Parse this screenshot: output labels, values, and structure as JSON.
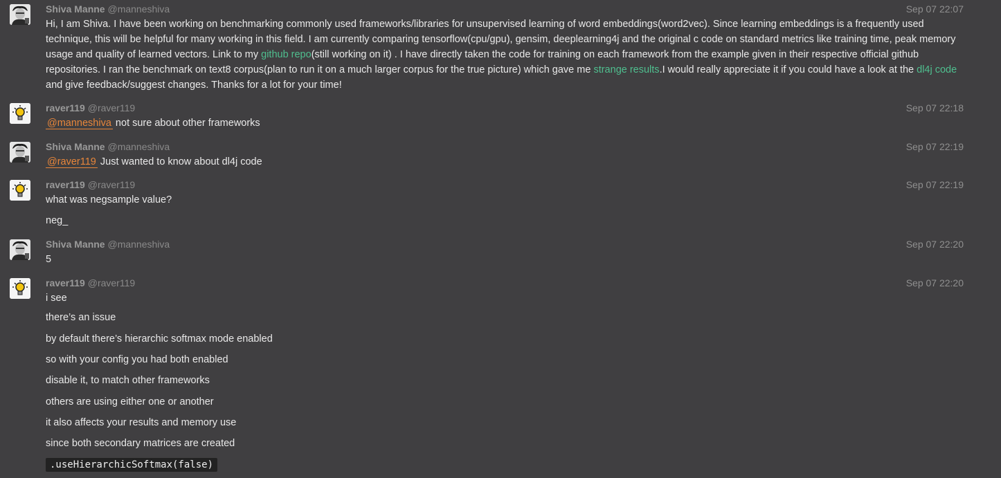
{
  "messages": [
    {
      "name": "Shiva Manne",
      "handle": "@manneshiva",
      "time": "Sep 07 22:07",
      "body": {
        "t1": "Hi, I am Shiva. I have been working on benchmarking commonly used frameworks/libraries for unsupervised learning of word embeddings(word2vec). Since learning embeddings is a frequently used technique, this will be helpful for many working in this field. I am currently comparing tensorflow(cpu/gpu), gensim, deeplearning4j and the original c code on standard metrics like training time, peak memory usage and quality of learned vectors. Link to my ",
        "link1": "github repo",
        "t2": "(still working on it) . I have directly taken the code for training on each framework from the example given in their respective official github repositories. I ran the benchmark on text8 corpus(plan to run it on a much larger corpus for the true picture) which gave me ",
        "link2": "strange results",
        "t3": ".I would really appreciate it if you could have a look at the ",
        "link3": "dl4j code",
        "t4": " and give feedback/suggest changes. Thanks for a lot for your time!"
      }
    },
    {
      "name": "raver119",
      "handle": "@raver119",
      "time": "Sep 07 22:18",
      "mention": "@manneshiva",
      "text": " not sure about other frameworks"
    },
    {
      "name": "Shiva Manne",
      "handle": "@manneshiva",
      "time": "Sep 07 22:19",
      "mention": "@raver119",
      "text": " Just wanted to know about dl4j code"
    },
    {
      "name": "raver119",
      "handle": "@raver119",
      "time": "Sep 07 22:19",
      "lines": [
        "what was negsample value?",
        "neg_"
      ]
    },
    {
      "name": "Shiva Manne",
      "handle": "@manneshiva",
      "time": "Sep 07 22:20",
      "lines": [
        "5"
      ]
    },
    {
      "name": "raver119",
      "handle": "@raver119",
      "time": "Sep 07 22:20",
      "lines": [
        "i see",
        "there’s an issue",
        "by default there’s hierarchic softmax mode enabled",
        "so with your config you had both enabled",
        "disable it, to match other frameworks",
        "others are using either one or another",
        "it also affects your results and memory use",
        "since both secondary matrices are created"
      ],
      "code": ".useHierarchicSoftmax(false)"
    }
  ],
  "icons": {
    "shiva_avatar": "person-photo-avatar",
    "raver_avatar": "lightbulb-avatar"
  },
  "colors": {
    "background": "#403f41",
    "link": "#4fbf8f",
    "mention": "#e8863a",
    "code_bg": "#222222"
  }
}
